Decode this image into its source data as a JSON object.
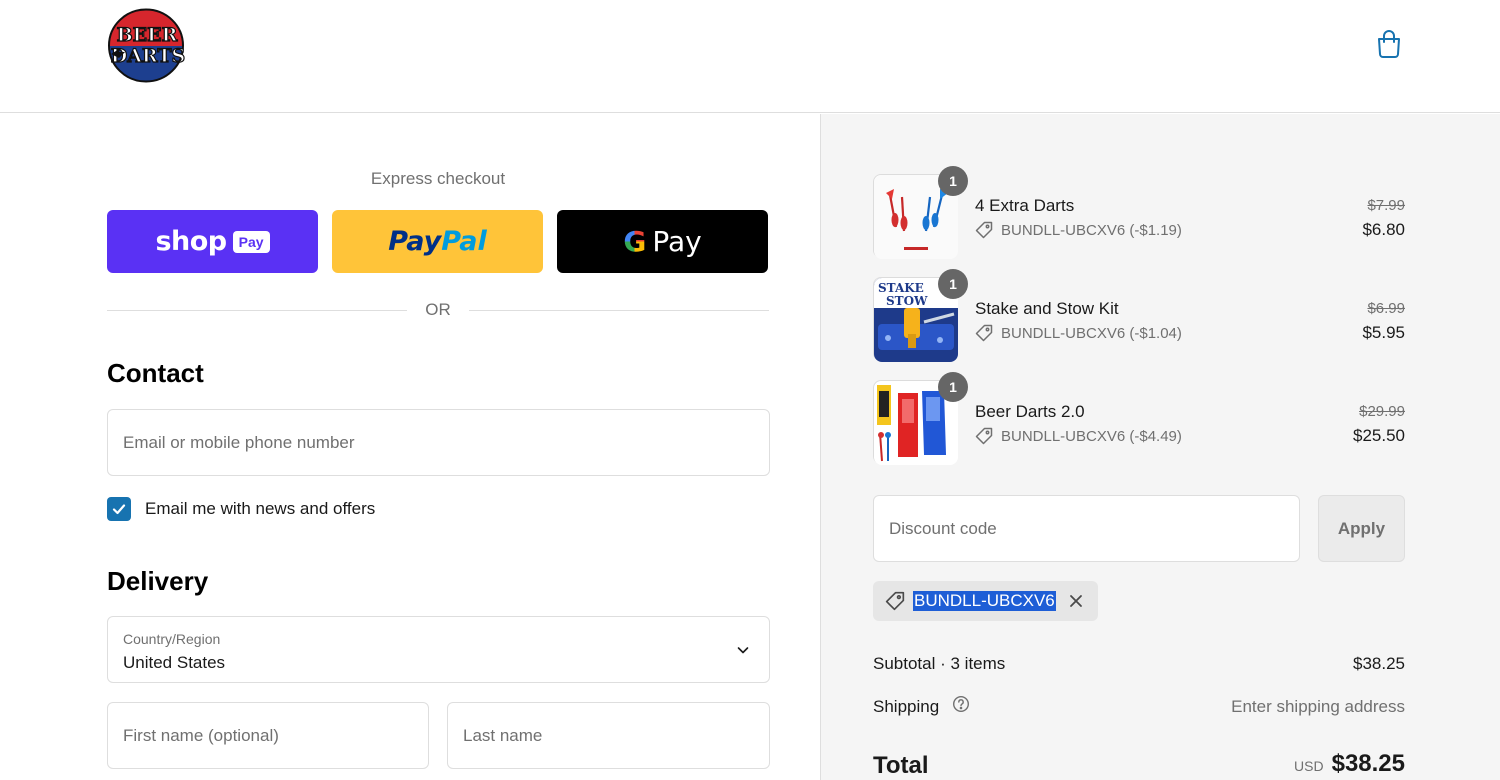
{
  "header": {
    "logo_text": [
      "BEER",
      "DARTS"
    ],
    "cart_icon": "shopping-bag-icon",
    "colors": {
      "logo_red": "#d6262d",
      "logo_blue": "#1d3f8f",
      "accent": "#1773b0"
    }
  },
  "express": {
    "title": "Express checkout",
    "shop_pay": {
      "word": "shop",
      "badge": "Pay",
      "color": "#5a31f4"
    },
    "paypal": {
      "pay": "Pay",
      "pal": "Pal",
      "color": "#ffc439"
    },
    "gpay": {
      "g": "G",
      "word": "Pay",
      "color": "#000000"
    },
    "or": "OR"
  },
  "contact": {
    "title": "Contact",
    "email_placeholder": "Email or mobile phone number",
    "newsletter_label": "Email me with news and offers",
    "newsletter_checked": true
  },
  "delivery": {
    "title": "Delivery",
    "country_caption": "Country/Region",
    "country_value": "United States",
    "first_name_placeholder": "First name (optional)",
    "last_name_placeholder": "Last name"
  },
  "cart": {
    "items": [
      {
        "name": "4 Extra Darts",
        "discount": "BUNDLL-UBCXV6 (-$1.19)",
        "old_price": "$7.99",
        "price": "$6.80",
        "qty": "1"
      },
      {
        "name": "Stake and Stow Kit",
        "discount": "BUNDLL-UBCXV6 (-$1.04)",
        "old_price": "$6.99",
        "price": "$5.95",
        "qty": "1"
      },
      {
        "name": "Beer Darts 2.0",
        "discount": "BUNDLL-UBCXV6 (-$4.49)",
        "old_price": "$29.99",
        "price": "$25.50",
        "qty": "1"
      }
    ],
    "thumb_texts": {
      "stake": [
        "STAKE",
        "STOW"
      ]
    },
    "discount_placeholder": "Discount code",
    "apply_label": "Apply",
    "applied_code": "BUNDLL-UBCXV6",
    "subtotal_label": "Subtotal · 3 items",
    "subtotal_value": "$38.25",
    "shipping_label": "Shipping",
    "shipping_value": "Enter shipping address",
    "total_label": "Total",
    "currency": "USD",
    "total_value": "$38.25"
  }
}
